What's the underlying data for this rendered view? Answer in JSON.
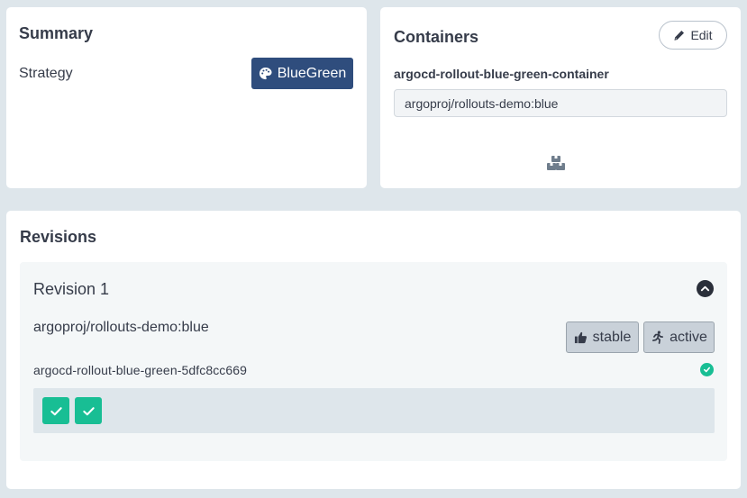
{
  "summary": {
    "title": "Summary",
    "strategy_label": "Strategy",
    "strategy_value": "BlueGreen",
    "strategy_icon": "palette-icon",
    "badge_color": "#2f4d7d"
  },
  "containers": {
    "title": "Containers",
    "edit_label": "Edit",
    "edit_icon": "pencil-icon",
    "container_name": "argocd-rollout-blue-green-container",
    "image_value": "argoproj/rollouts-demo:blue",
    "boxes_icon": "boxes-icon"
  },
  "revisions": {
    "title": "Revisions",
    "items": [
      {
        "title": "Revision 1",
        "image": "argoproj/rollouts-demo:blue",
        "tags": [
          {
            "label": "stable",
            "icon": "thumbs-up-icon"
          },
          {
            "label": "active",
            "icon": "running-icon"
          }
        ],
        "replicaset": "argocd-rollout-blue-green-5dfc8cc669",
        "replicaset_status": "healthy",
        "pods": [
          {
            "status": "healthy"
          },
          {
            "status": "healthy"
          }
        ]
      }
    ]
  },
  "colors": {
    "background": "#dee6eb",
    "healthy": "#18be94",
    "tag_background": "#c9d1d9"
  }
}
